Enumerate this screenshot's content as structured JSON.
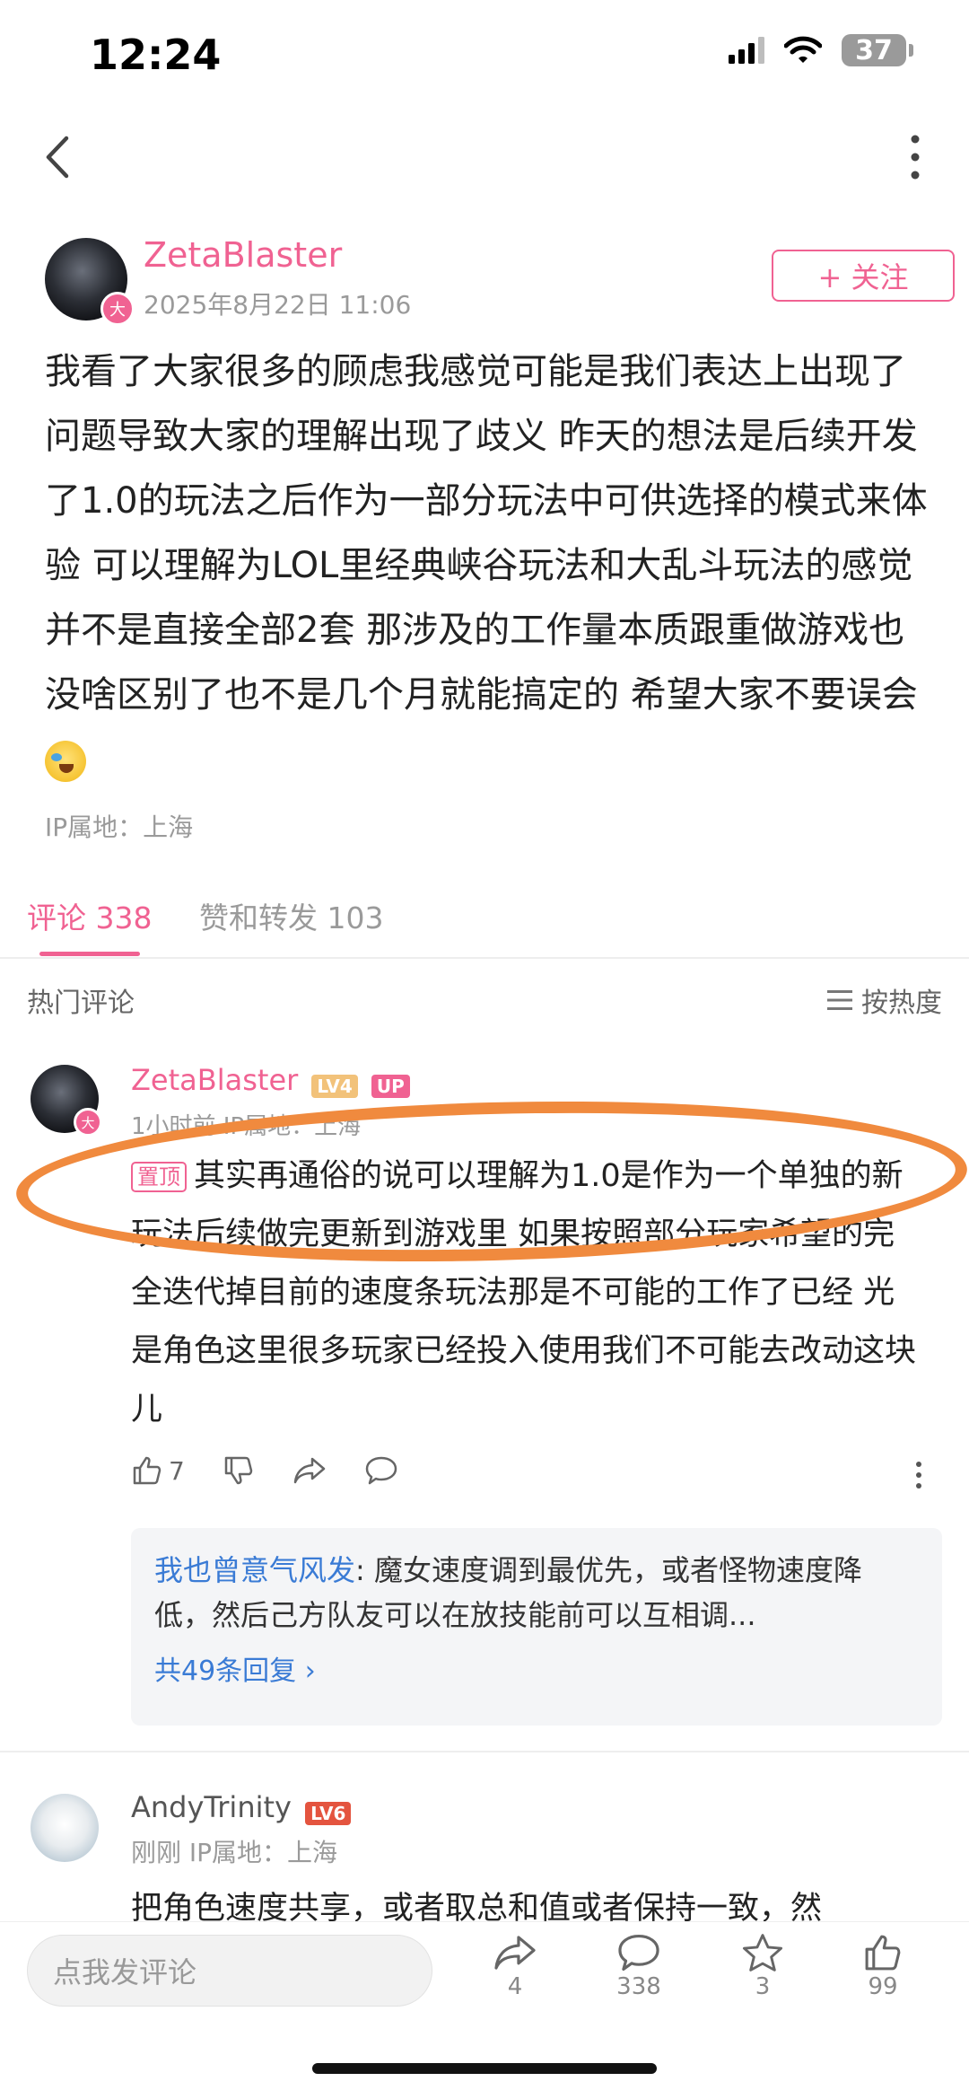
{
  "status_bar": {
    "time": "12:24",
    "battery": "37"
  },
  "post": {
    "author": "ZetaBlaster",
    "avatar_badge": "大",
    "date": "2025年8月22日 11:06",
    "follow_label": "+ 关注",
    "body": "我看了大家很多的顾虑我感觉可能是我们表达上出现了问题导致大家的理解出现了歧义 昨天的想法是后续开发了1.0的玩法之后作为一部分玩法中可供选择的模式来体验 可以理解为LOL里经典峡谷玩法和大乱斗玩法的感觉 并不是直接全部2套 那涉及的工作量本质跟重做游戏也没啥区别了也不是几个月就能搞定的 希望大家不要误会",
    "ip": "IP属地：上海"
  },
  "tabs": {
    "comments": "评论 338",
    "likes_shares": "赞和转发 103"
  },
  "hot_comments_label": "热门评论",
  "sort_label": "按热度",
  "comments": [
    {
      "name": "ZetaBlaster",
      "level": "LV4",
      "up_badge": "UP",
      "avatar_badge": "大",
      "meta": "1小时前 IP属地：上海",
      "pin_label": "置顶",
      "body": "其实再通俗的说可以理解为1.0是作为一个单独的新玩法后续做完更新到游戏里 如果按照部分玩家希望的完全迭代掉目前的速度条玩法那是不可能的工作了已经 光是角色这里很多玩家已经投入使用我们不可能去改动这块儿",
      "like_count": "7",
      "reply": {
        "author": "我也曾意气风发",
        "text": ": 魔女速度调到最优先，或者怪物速度降低，然后己方队友可以在放技能前可以互相调...",
        "more": "共49条回复 ›"
      }
    },
    {
      "name": "AndyTrinity",
      "level": "LV6",
      "meta": "刚刚  IP属地：上海",
      "body": "把角色速度共享，或者取总和值或者保持一致，然"
    }
  ],
  "bottom_bar": {
    "input_placeholder": "点我发评论",
    "share_count": "4",
    "comment_count": "338",
    "star_count": "3",
    "like_count": "99"
  }
}
